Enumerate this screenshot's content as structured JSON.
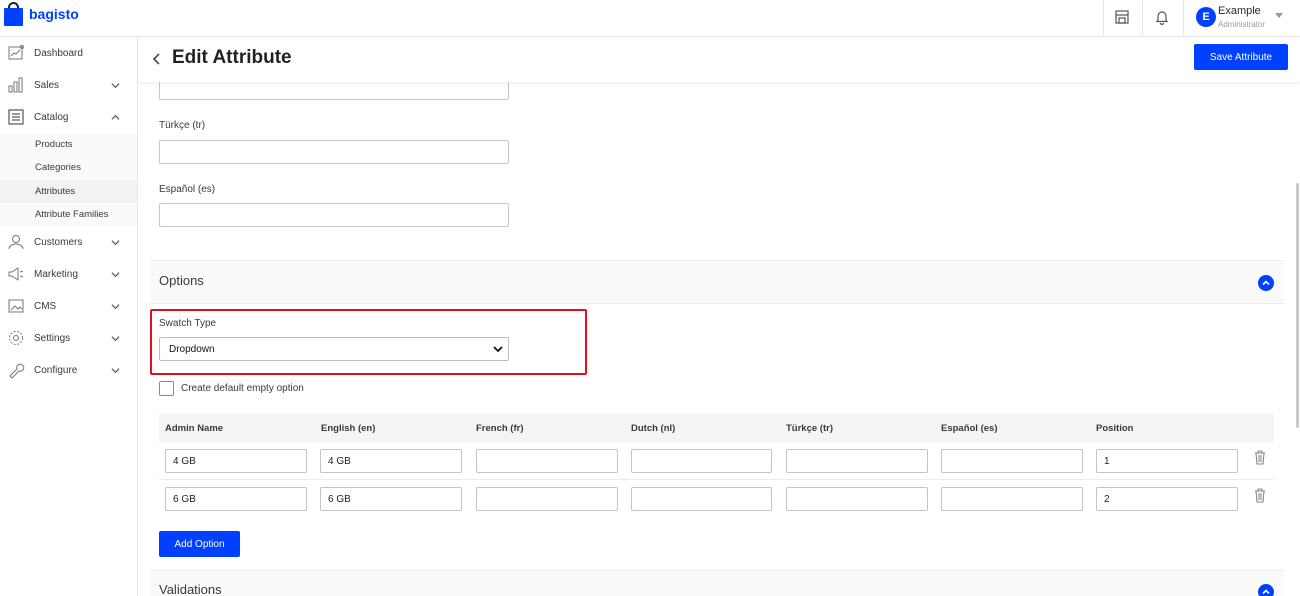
{
  "app": {
    "logo_text": "bagisto"
  },
  "topbar": {
    "user_initial": "E",
    "user_name": "Example",
    "user_role": "Administrator"
  },
  "sidebar": {
    "items": [
      {
        "label": "Dashboard",
        "icon": "dashboard-icon"
      },
      {
        "label": "Sales",
        "icon": "sales-icon"
      },
      {
        "label": "Catalog",
        "icon": "catalog-icon"
      },
      {
        "label": "Customers",
        "icon": "customers-icon"
      },
      {
        "label": "Marketing",
        "icon": "marketing-icon"
      },
      {
        "label": "CMS",
        "icon": "cms-icon"
      },
      {
        "label": "Settings",
        "icon": "settings-icon"
      },
      {
        "label": "Configure",
        "icon": "configure-icon"
      }
    ],
    "catalog_sub": [
      {
        "label": "Products"
      },
      {
        "label": "Categories"
      },
      {
        "label": "Attributes"
      },
      {
        "label": "Attribute Families"
      }
    ]
  },
  "header": {
    "title": "Edit Attribute",
    "save_label": "Save Attribute"
  },
  "labels": {
    "turkish": "Türkçe (tr)",
    "spanish": "Español (es)"
  },
  "options_section": {
    "title": "Options",
    "swatch_label": "Swatch Type",
    "swatch_value": "Dropdown",
    "empty_option_label": "Create default empty option",
    "columns": [
      "Admin Name",
      "English (en)",
      "French (fr)",
      "Dutch (nl)",
      "Türkçe (tr)",
      "Español (es)",
      "Position"
    ],
    "rows": [
      {
        "admin": "4 GB",
        "en": "4 GB",
        "fr": "",
        "nl": "",
        "tr": "",
        "es": "",
        "position": "1"
      },
      {
        "admin": "6 GB",
        "en": "6 GB",
        "fr": "",
        "nl": "",
        "tr": "",
        "es": "",
        "position": "2"
      }
    ],
    "add_option_label": "Add Option"
  },
  "validations_section": {
    "title": "Validations"
  },
  "colors": {
    "accent": "#0041ff",
    "highlight": "#e0101e"
  }
}
